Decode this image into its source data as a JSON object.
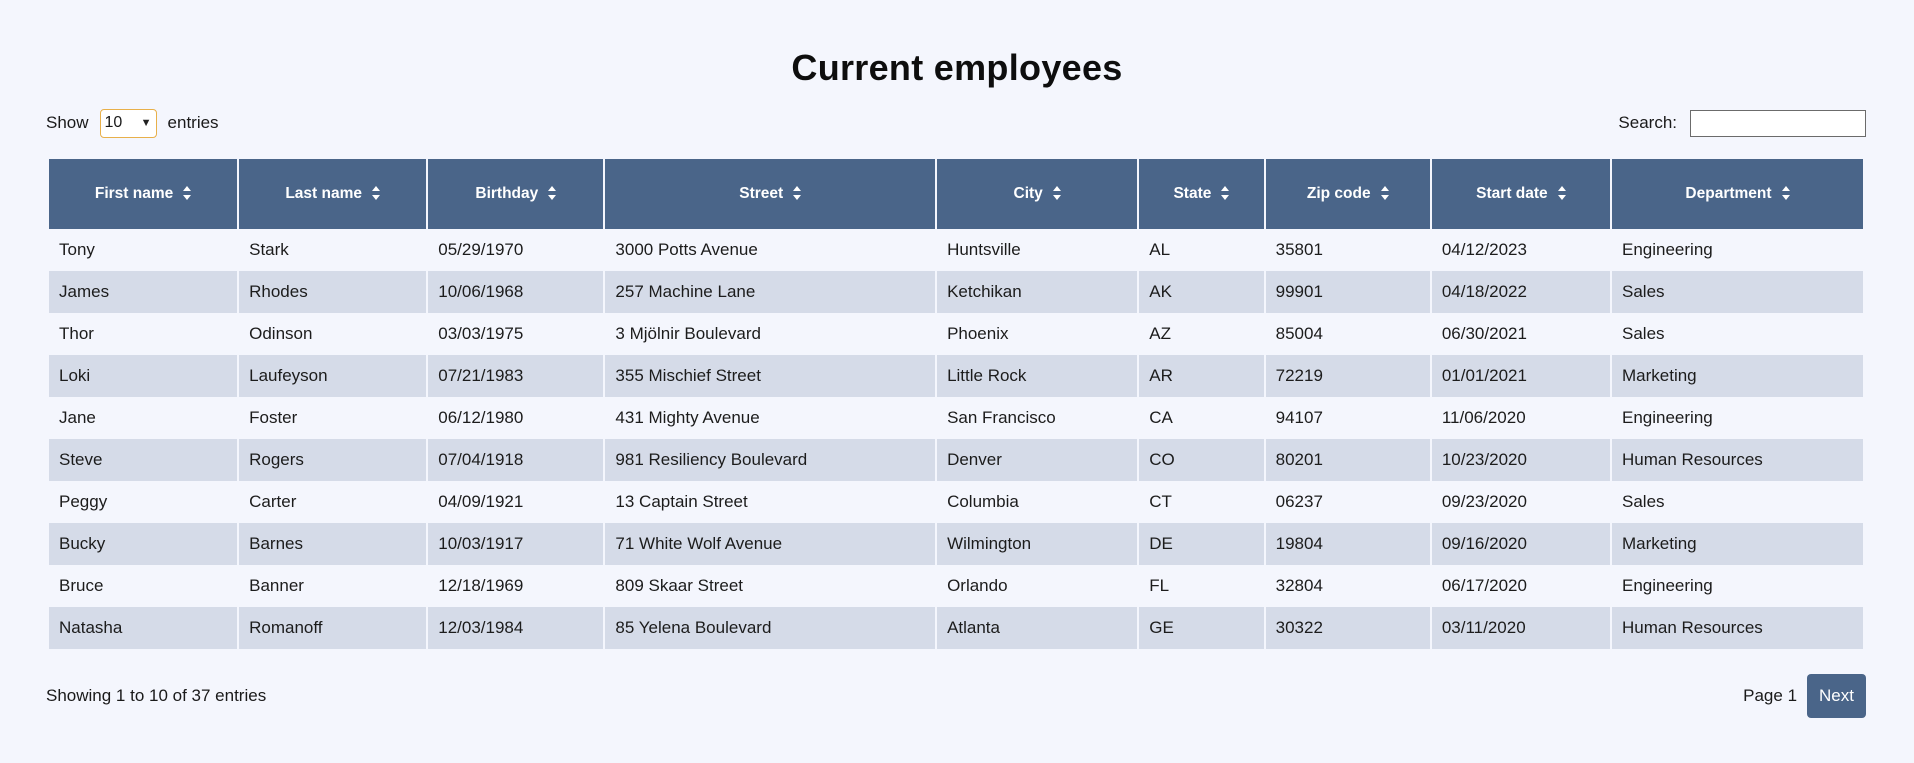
{
  "page": {
    "title": "Current employees"
  },
  "controls": {
    "show_label": "Show",
    "page_size": "10",
    "entries_label": "entries",
    "search_label": "Search:",
    "search_value": ""
  },
  "table": {
    "columns": [
      "First name",
      "Last name",
      "Birthday",
      "Street",
      "City",
      "State",
      "Zip code",
      "Start date",
      "Department"
    ],
    "rows": [
      [
        "Tony",
        "Stark",
        "05/29/1970",
        "3000 Potts Avenue",
        "Huntsville",
        "AL",
        "35801",
        "04/12/2023",
        "Engineering"
      ],
      [
        "James",
        "Rhodes",
        "10/06/1968",
        "257 Machine Lane",
        "Ketchikan",
        "AK",
        "99901",
        "04/18/2022",
        "Sales"
      ],
      [
        "Thor",
        "Odinson",
        "03/03/1975",
        "3 Mjölnir Boulevard",
        "Phoenix",
        "AZ",
        "85004",
        "06/30/2021",
        "Sales"
      ],
      [
        "Loki",
        "Laufeyson",
        "07/21/1983",
        "355 Mischief Street",
        "Little Rock",
        "AR",
        "72219",
        "01/01/2021",
        "Marketing"
      ],
      [
        "Jane",
        "Foster",
        "06/12/1980",
        "431 Mighty Avenue",
        "San Francisco",
        "CA",
        "94107",
        "11/06/2020",
        "Engineering"
      ],
      [
        "Steve",
        "Rogers",
        "07/04/1918",
        "981 Resiliency Boulevard",
        "Denver",
        "CO",
        "80201",
        "10/23/2020",
        "Human Resources"
      ],
      [
        "Peggy",
        "Carter",
        "04/09/1921",
        "13 Captain Street",
        "Columbia",
        "CT",
        "06237",
        "09/23/2020",
        "Sales"
      ],
      [
        "Bucky",
        "Barnes",
        "10/03/1917",
        "71 White Wolf Avenue",
        "Wilmington",
        "DE",
        "19804",
        "09/16/2020",
        "Marketing"
      ],
      [
        "Bruce",
        "Banner",
        "12/18/1969",
        "809 Skaar Street",
        "Orlando",
        "FL",
        "32804",
        "06/17/2020",
        "Engineering"
      ],
      [
        "Natasha",
        "Romanoff",
        "12/03/1984",
        "85 Yelena Boulevard",
        "Atlanta",
        "GE",
        "30322",
        "03/11/2020",
        "Human Resources"
      ]
    ]
  },
  "footer": {
    "info": "Showing 1 to 10 of 37 entries",
    "page_label": "Page 1",
    "next_label": "Next"
  },
  "colors": {
    "header_bg": "#4a6589",
    "row_stripe": "#d5dbe8",
    "page_bg": "#f4f6fd",
    "select_border": "#e8b04a"
  }
}
